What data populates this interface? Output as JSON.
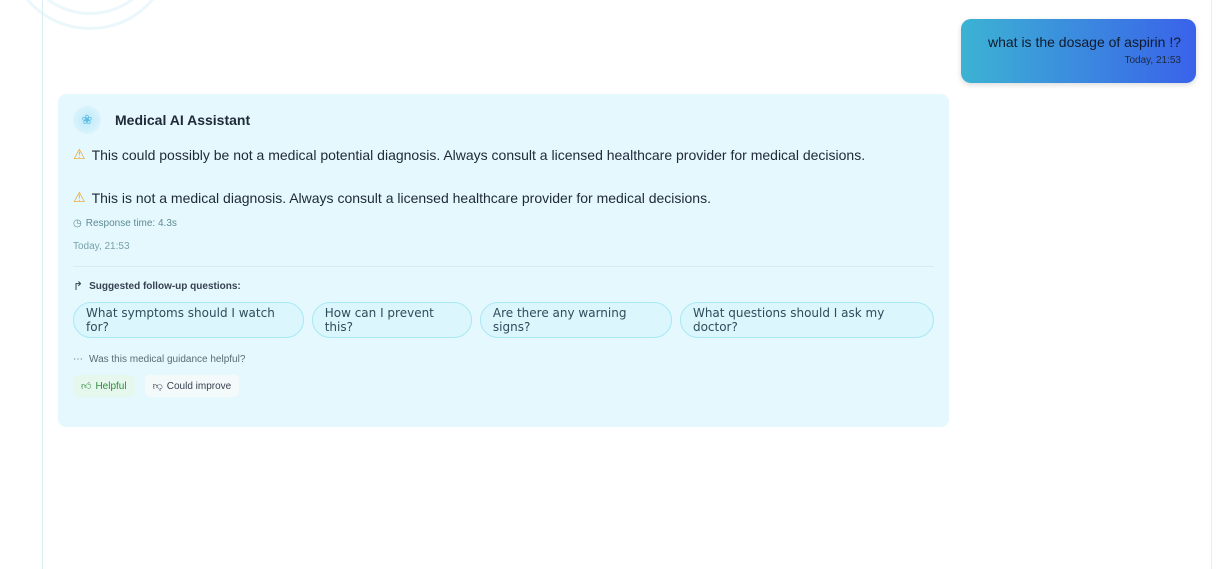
{
  "user_message": {
    "text": "what is the dosage of aspirin !?",
    "timestamp": "Today, 21:53"
  },
  "assistant": {
    "name": "Medical AI Assistant",
    "warnings": [
      "This could possibly be not a medical potential diagnosis. Always consult a licensed healthcare provider for medical decisions.",
      "This is not a medical diagnosis. Always consult a licensed healthcare provider for medical decisions."
    ],
    "response_time": "Response time: 4.3s",
    "timestamp": "Today, 21:53",
    "suggested_label": "Suggested follow-up questions:",
    "suggestions": [
      "What symptoms should I watch for?",
      "How can I prevent this?",
      "Are there any warning signs?",
      "What questions should I ask my doctor?"
    ],
    "feedback_question": "Was this medical guidance helpful?",
    "helpful_label": "Helpful",
    "improve_label": "Could improve"
  }
}
